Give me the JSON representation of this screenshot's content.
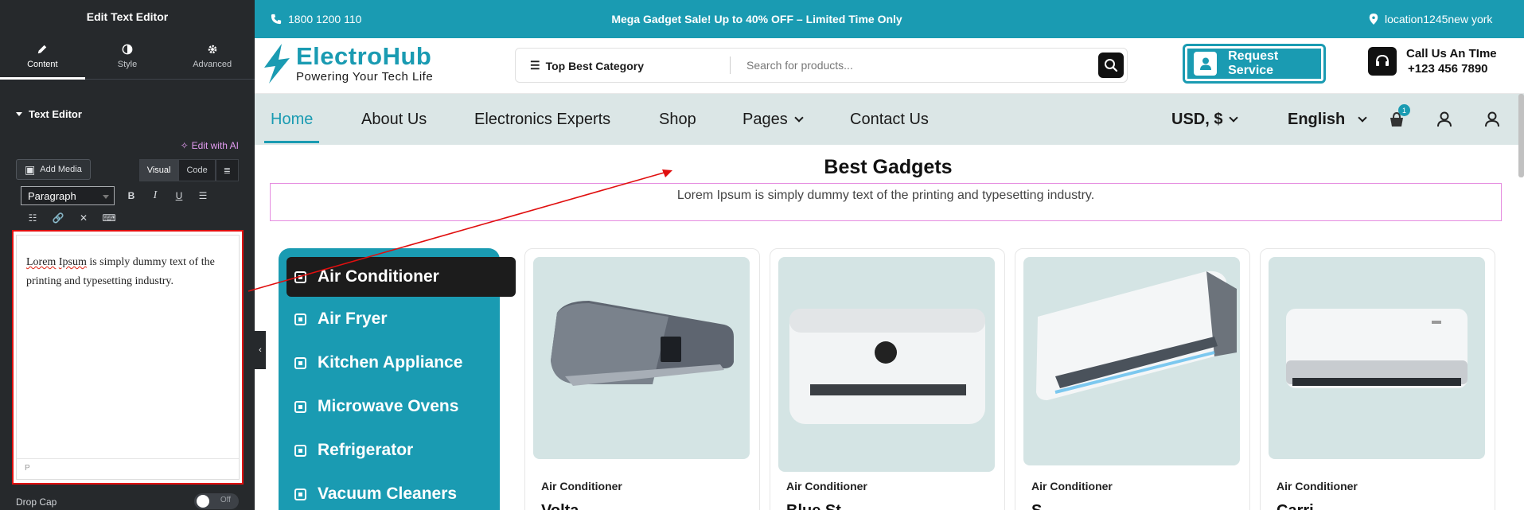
{
  "panel": {
    "title": "Edit Text Editor",
    "tabs": [
      {
        "label": "Content"
      },
      {
        "label": "Style"
      },
      {
        "label": "Advanced"
      }
    ],
    "section_title": "Text Editor",
    "edit_with_ai": "Edit with AI",
    "add_media": "Add Media",
    "mode_visual": "Visual",
    "mode_code": "Code",
    "format_select": "Paragraph",
    "editor_word1": "Lorem",
    "editor_word2": "Ipsum",
    "editor_rest": " is simply dummy text of the printing and typesetting industry.",
    "editor_footer": "P",
    "drop_cap_label": "Drop Cap",
    "drop_cap_value": "Off"
  },
  "site": {
    "topbar": {
      "phone": "1800 1200 110",
      "promo": "Mega Gadget Sale! Up to 40% OFF – Limited Time Only",
      "location": "location1245new york"
    },
    "logo": {
      "name": "ElectroHub",
      "tagline": "Powering Your Tech Life"
    },
    "search": {
      "category": "Top Best Category",
      "placeholder": "Search for products..."
    },
    "request_service": "Request Service",
    "call": {
      "line1": "Call Us An TIme",
      "line2": "+123 456 7890"
    },
    "nav": [
      {
        "label": "Home"
      },
      {
        "label": "About Us"
      },
      {
        "label": "Electronics Experts"
      },
      {
        "label": "Shop"
      },
      {
        "label": "Pages"
      },
      {
        "label": "Contact Us"
      }
    ],
    "currency": "USD, $",
    "language": "English",
    "cart_count": "1",
    "section_title": "Best Gadgets",
    "section_text": "Lorem Ipsum is simply dummy text of the printing and typesetting industry.",
    "categories": [
      {
        "label": "Air Conditioner"
      },
      {
        "label": "Air Fryer"
      },
      {
        "label": "Kitchen Appliance"
      },
      {
        "label": "Microwave Ovens"
      },
      {
        "label": "Refrigerator"
      },
      {
        "label": "Vacuum Cleaners"
      }
    ],
    "products": [
      {
        "category": "Air Conditioner",
        "name": "Volta"
      },
      {
        "category": "Air Conditioner",
        "name": "Blue St"
      },
      {
        "category": "Air Conditioner",
        "name": "S"
      },
      {
        "category": "Air Conditioner",
        "name": "Carri"
      }
    ],
    "colors": {
      "brand": "#1a9bb2",
      "dark": "#1c1c1c",
      "nav_bg": "#dbe6e6",
      "highlight_border": "#e00f0f"
    }
  }
}
